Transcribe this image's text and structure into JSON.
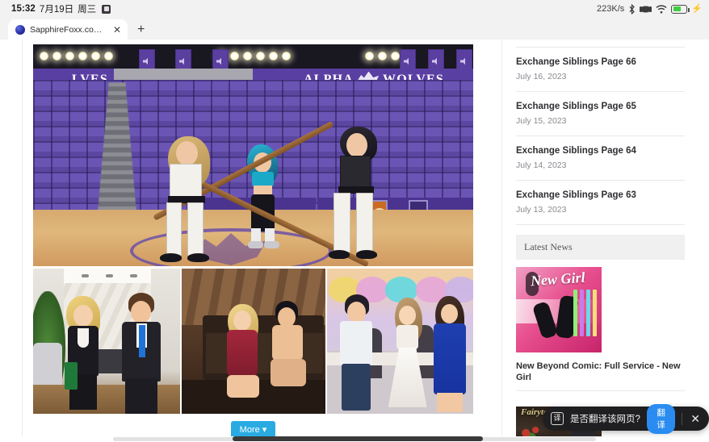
{
  "status_bar": {
    "time": "15:32",
    "date": "7月19日",
    "weekday": "周三",
    "record_icon": "screen-record-icon",
    "network_speed": "223K/s",
    "bluetooth_icon": "bluetooth-icon",
    "vpn_icon": "vpn-icon",
    "wifi_icon": "wifi-icon",
    "battery_icon": "battery-icon",
    "charging_icon": "⚡"
  },
  "browser": {
    "tab_title": "SapphireFoxx.com | ...",
    "favicon": "site-favicon",
    "close_label": "✕",
    "new_tab_label": "+"
  },
  "hero": {
    "banner_left_text": "LVES",
    "banner_right_text_1": "ALPHA",
    "banner_right_text_2": "WOLVES",
    "alt": "Alpha Wolves arena comic panel"
  },
  "panels": [
    {
      "alt": "Office scene with blonde woman and man in suit"
    },
    {
      "alt": "Bedroom scene"
    },
    {
      "alt": "Wedding reception scene"
    }
  ],
  "content": {
    "more_button": "More"
  },
  "sidebar": {
    "posts": [
      {
        "title": "Exchange Siblings Page 66",
        "date": "July 16, 2023"
      },
      {
        "title": "Exchange Siblings Page 65",
        "date": "July 15, 2023"
      },
      {
        "title": "Exchange Siblings Page 64",
        "date": "July 14, 2023"
      },
      {
        "title": "Exchange Siblings Page 63",
        "date": "July 13, 2023"
      }
    ],
    "news_heading": "Latest News",
    "news": [
      {
        "thumb_title": "New Girl",
        "title": "New Beyond Comic: Full Service - New Girl"
      },
      {
        "thumb_title": "Fairytale Perspectives"
      }
    ]
  },
  "translate_toast": {
    "icon_glyph": "译",
    "message": "是否翻译该网页?",
    "action_label": "翻译",
    "close_label": "✕"
  },
  "colors": {
    "accent_blue": "#29abe2",
    "translate_blue": "#2a8cf0",
    "arena_purple": "#5a3fa3",
    "toast_bg": "#1f1f21",
    "news_head_bg": "#f0f0f0"
  }
}
